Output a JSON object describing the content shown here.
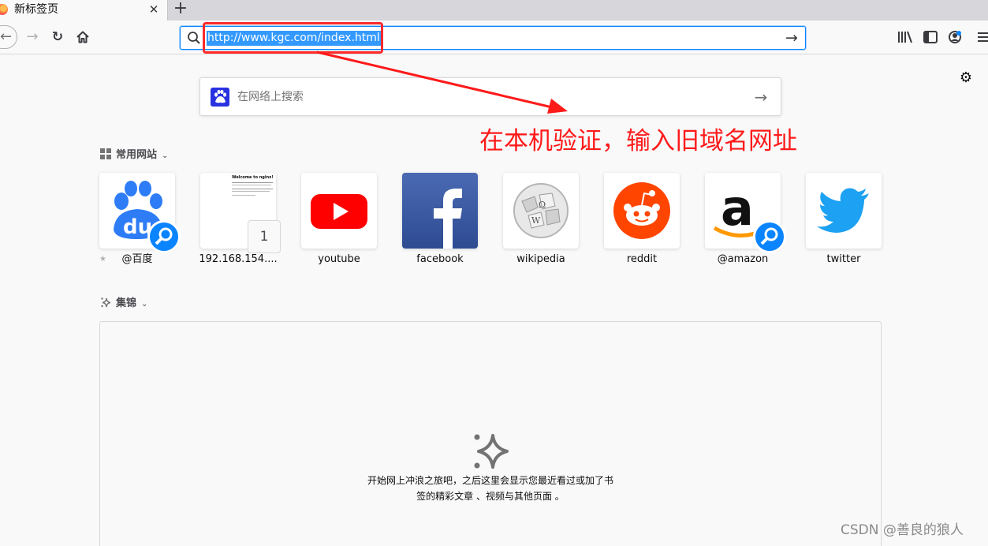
{
  "browser": {
    "tab": {
      "title": "新标签页",
      "close_glyph": "✕"
    },
    "newtab_glyph": "+",
    "nav": {
      "back_glyph": "←",
      "forward_glyph": "→",
      "reload_glyph": "↻",
      "home_icon": "home-icon"
    },
    "urlbar": {
      "value": "http://www.kgc.com/index.html",
      "go_glyph": "→"
    },
    "toolbar": {
      "library_icon": "library-icon",
      "sidebar_icon": "sidebar-icon",
      "account_icon": "account-icon",
      "menu_icon": "menu-icon"
    }
  },
  "newtab": {
    "settings_glyph": "⚙",
    "search": {
      "placeholder": "在网络上搜索",
      "arrow_glyph": "→",
      "engine_icon": "baidu-paw-icon"
    },
    "topsites": {
      "heading": "常用网站",
      "chevron": "⌄",
      "sites": [
        {
          "label": "@百度",
          "icon": "baidu-icon",
          "search_shortcut": true
        },
        {
          "label": "192.168.154....",
          "icon": "nginx-screenshot",
          "badge": "1"
        },
        {
          "label": "youtube",
          "icon": "youtube-icon"
        },
        {
          "label": "facebook",
          "icon": "facebook-icon"
        },
        {
          "label": "wikipedia",
          "icon": "wikipedia-icon"
        },
        {
          "label": "reddit",
          "icon": "reddit-icon"
        },
        {
          "label": "@amazon",
          "icon": "amazon-icon",
          "search_shortcut": true
        },
        {
          "label": "twitter",
          "icon": "twitter-icon"
        }
      ],
      "thumbnail_heading": "Welcome to nginx!"
    },
    "highlights": {
      "heading": "集锦",
      "chevron": "⌄",
      "empty_line1": "开始网上冲浪之旅吧，之后这里会显示您最近看过或加了书",
      "empty_line2": "签的精彩文章 、视频与其他页面 。"
    }
  },
  "annotation": {
    "text": "在本机验证，输入旧域名网址",
    "color": "#ff1a1a"
  },
  "watermark": "CSDN @善良的狼人"
}
